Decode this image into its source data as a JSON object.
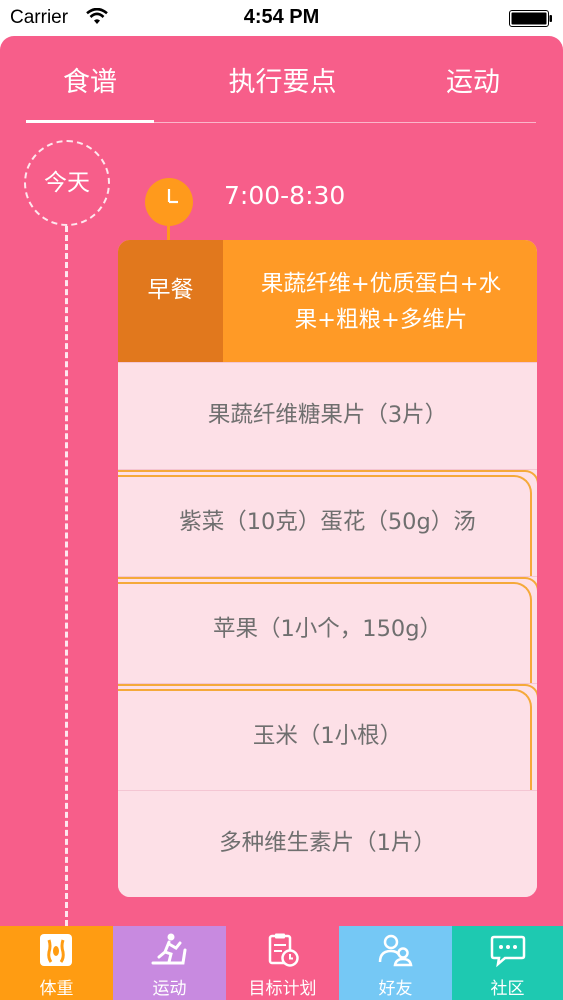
{
  "status_bar": {
    "carrier": "Carrier",
    "time": "4:54 PM"
  },
  "tabs": [
    {
      "label": "食谱",
      "active": true
    },
    {
      "label": "执行要点",
      "active": false
    },
    {
      "label": "运动",
      "active": false
    }
  ],
  "timeline": {
    "today_label": "今天"
  },
  "meal": {
    "time": "7:00-8:30",
    "label": "早餐",
    "summary_line1": "果蔬纤维+优质蛋白+水",
    "summary_line2": "果+粗粮+多维片",
    "items": [
      "果蔬纤维糖果片（3片）",
      "紫菜（10克）蛋花（50g）汤",
      "苹果（1小个，150g）",
      "玉米（1小根）",
      "多种维生素片（1片）"
    ]
  },
  "bottom_nav": [
    {
      "label": "体重",
      "icon": "weight-icon",
      "color": "#ff9c12"
    },
    {
      "label": "运动",
      "icon": "treadmill-icon",
      "color": "#c88ae0"
    },
    {
      "label": "目标计划",
      "icon": "clipboard-clock-icon",
      "color": "#f75e8a"
    },
    {
      "label": "好友",
      "icon": "friends-icon",
      "color": "#75c8f5"
    },
    {
      "label": "社区",
      "icon": "chat-icon",
      "color": "#1ec9b1"
    }
  ],
  "colors": {
    "primary_pink": "#f75e8a",
    "accent_orange": "#ff9a26",
    "accent_dark_orange": "#e1781d",
    "row_bg": "#fde0e7"
  }
}
